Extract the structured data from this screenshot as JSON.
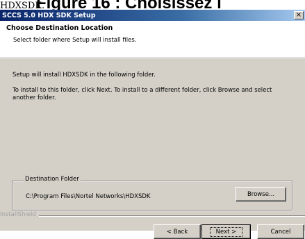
{
  "caption": {
    "prefix": "HDXSDK.",
    "text": "Figure 16 : Choisissez l"
  },
  "window": {
    "title": "SCCS 5.0 HDX SDK Setup",
    "close_glyph": "×"
  },
  "header": {
    "title": "Choose Destination Location",
    "subtitle": "Select folder where Setup will install files."
  },
  "body": {
    "intro": "Setup will install HDXSDK in the following folder.",
    "instructions": "To install to this folder, click Next. To install to a different folder, click Browse and select another folder."
  },
  "destination": {
    "legend": "Destination Folder",
    "path": "C:\\Program Files\\Nortel Networks\\HDXSDK",
    "browse_label": "Browse..."
  },
  "footer": {
    "brand": "InstallShield",
    "back_label": "< Back",
    "next_label": "Next >",
    "cancel_label": "Cancel"
  }
}
